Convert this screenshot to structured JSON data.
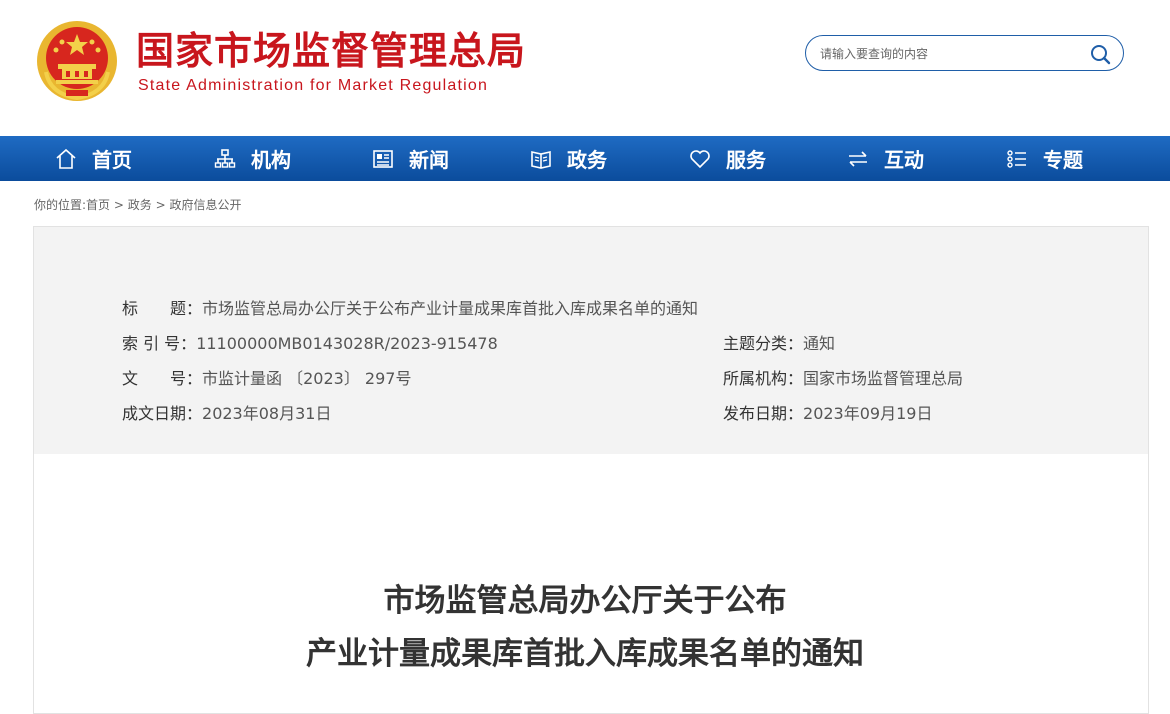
{
  "header": {
    "site_name_cn": "国家市场监督管理总局",
    "site_name_en": "State Administration for Market Regulation",
    "search": {
      "placeholder": "请输入要查询的内容"
    }
  },
  "nav": {
    "items": [
      {
        "label": "首页",
        "icon": "home-icon"
      },
      {
        "label": "机构",
        "icon": "org-chart-icon"
      },
      {
        "label": "新闻",
        "icon": "newspaper-icon"
      },
      {
        "label": "政务",
        "icon": "open-book-icon"
      },
      {
        "label": "服务",
        "icon": "heart-icon"
      },
      {
        "label": "互动",
        "icon": "exchange-arrows-icon"
      },
      {
        "label": "专题",
        "icon": "list-icon"
      }
    ]
  },
  "breadcrumb": {
    "prefix": "你的位置:",
    "items": [
      "首页",
      "政务",
      "政府信息公开"
    ],
    "separator": ">"
  },
  "meta": {
    "title_label": "标　　题：",
    "title_value": "市场监管总局办公厅关于公布产业计量成果库首批入库成果名单的通知",
    "index_label": "索 引 号：",
    "index_value": "11100000MB0143028R/2023-915478",
    "category_label": "主题分类：",
    "category_value": "通知",
    "doc_no_label": "文　　号：",
    "doc_no_value": "市监计量函 〔2023〕 297号",
    "org_label": "所属机构：",
    "org_value": "国家市场监督管理总局",
    "created_label": "成文日期：",
    "created_value": "2023年08月31日",
    "published_label": "发布日期：",
    "published_value": "2023年09月19日"
  },
  "document": {
    "title_line1": "市场监管总局办公厅关于公布",
    "title_line2": "产业计量成果库首批入库成果名单的通知"
  },
  "colors": {
    "brand_red": "#c8161d",
    "nav_blue": "#0b4c9c",
    "panel_gray": "#f3f3f3"
  }
}
